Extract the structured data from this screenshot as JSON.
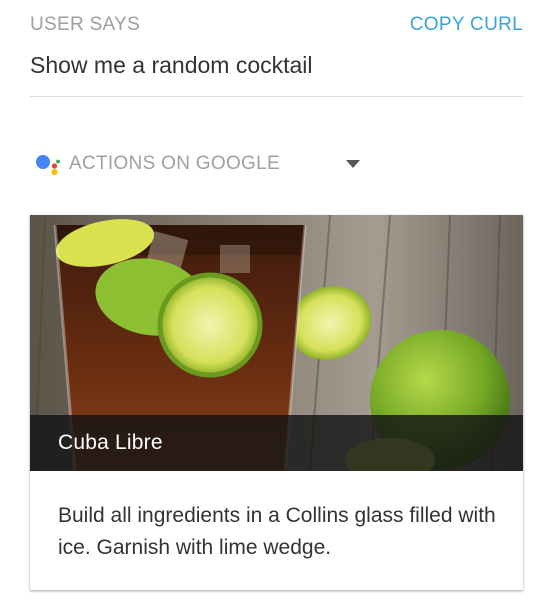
{
  "header": {
    "user_says_label": "USER SAYS",
    "copy_curl_label": "COPY CURL",
    "copy_curl_color": "#3aa3d6"
  },
  "query": {
    "text": "Show me a random cocktail"
  },
  "agent_select": {
    "selected_label": "ACTIONS ON GOOGLE",
    "icon": "google-assistant-icon",
    "dropdown_icon": "caret-down-icon"
  },
  "card": {
    "image_alt": "cuba-libre-photo",
    "title": "Cuba Libre",
    "text": "Build all ingredients in a Collins glass filled with ice. Garnish with lime wedge."
  }
}
